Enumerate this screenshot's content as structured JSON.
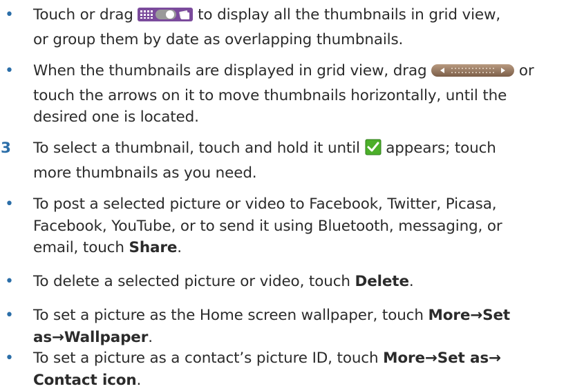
{
  "bullet_glyph": "•",
  "items": [
    {
      "marker": "•",
      "line1_pre": "Touch or drag ",
      "line1_post": " to display all the thumbnails in grid view,",
      "line2": "or group them by date as overlapping thumbnails."
    },
    {
      "marker": "•",
      "line1_pre": "When the thumbnails are displayed in grid view, drag ",
      "line1_post": " or",
      "line2": "touch the arrows on it to move thumbnails horizontally, until the",
      "line3": "desired one is located."
    },
    {
      "marker": "3",
      "line1_pre": "To select a thumbnail, touch and hold it until ",
      "line1_post": " appears; touch",
      "line2": "more thumbnails as you need."
    },
    {
      "marker": "•",
      "line1": "To post a selected picture or video to Facebook, Twitter, Picasa,",
      "line2": "Facebook, YouTube, or to send it using Bluetooth, messaging, or",
      "line3_pre": "email, touch ",
      "line3_bold": "Share",
      "line3_post": "."
    },
    {
      "marker": "•",
      "line1_pre": "To delete a selected picture or video, touch ",
      "line1_bold": "Delete",
      "line1_post": "."
    },
    {
      "marker": "•",
      "line1_pre": "To set a picture as the Home screen wallpaper, touch ",
      "line1_bold": "More→Set",
      "line2_bold": "as→Wallpaper",
      "line2_post": "."
    },
    {
      "marker": "•",
      "line1_pre": "To set a picture as a contact’s picture ID, touch ",
      "line1_bold": "More→Set as→",
      "line2_bold": "Contact icon",
      "line2_post": "."
    }
  ],
  "icons": {
    "view_toggle": "grid-view-toggle-icon",
    "scroll_bar": "thumbnail-scroll-bar-icon",
    "checkmark": "green-checkmark-icon"
  },
  "colors": {
    "text": "#2b2b2b",
    "marker": "#2b6ea8",
    "checkmark_green": "#4caf2a"
  }
}
